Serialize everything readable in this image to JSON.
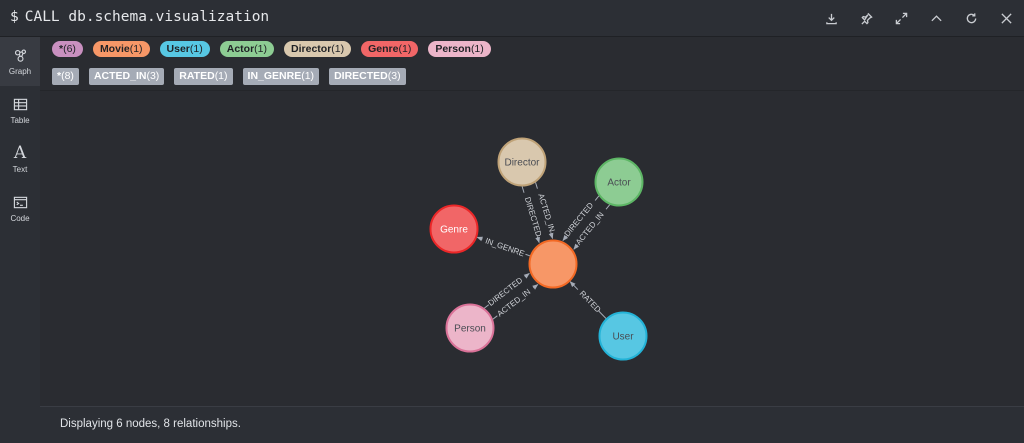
{
  "command": {
    "prompt": "$",
    "text": "CALL db.schema.visualization"
  },
  "toolbar": [
    "download-icon",
    "pin-icon",
    "expand-icon",
    "collapse-icon",
    "rerun-icon",
    "close-icon"
  ],
  "sidebar": {
    "items": [
      {
        "label": "Graph",
        "icon": "graph-icon",
        "active": true
      },
      {
        "label": "Table",
        "icon": "table-icon",
        "active": false
      },
      {
        "label": "Text",
        "icon": "text-icon",
        "glyph": "A",
        "active": false
      },
      {
        "label": "Code",
        "icon": "code-icon",
        "active": false
      }
    ]
  },
  "labels": [
    {
      "name": "*",
      "count": "(6)",
      "color": "#c990c0"
    },
    {
      "name": "Movie",
      "count": "(1)",
      "color": "#f79767"
    },
    {
      "name": "User",
      "count": "(1)",
      "color": "#57c7e3"
    },
    {
      "name": "Actor",
      "count": "(1)",
      "color": "#8dcc93"
    },
    {
      "name": "Director",
      "count": "(1)",
      "color": "#d9c8ae"
    },
    {
      "name": "Genre",
      "count": "(1)",
      "color": "#f16667"
    },
    {
      "name": "Person",
      "count": "(1)",
      "color": "#ecb5c9"
    }
  ],
  "relationships": [
    {
      "name": "*",
      "count": "(8)"
    },
    {
      "name": "ACTED_IN",
      "count": "(3)"
    },
    {
      "name": "RATED",
      "count": "(1)"
    },
    {
      "name": "IN_GENRE",
      "count": "(1)"
    },
    {
      "name": "DIRECTED",
      "count": "(3)"
    }
  ],
  "graph": {
    "nodes": [
      {
        "id": "movie",
        "label": "",
        "color": "#f79767",
        "stroke": "#f36924"
      },
      {
        "id": "director",
        "label": "Director",
        "color": "#d9c8ae",
        "stroke": "#c0a378"
      },
      {
        "id": "actor",
        "label": "Actor",
        "color": "#8dcc93",
        "stroke": "#5db665"
      },
      {
        "id": "genre",
        "label": "Genre",
        "color": "#f16667",
        "stroke": "#eb2728"
      },
      {
        "id": "person",
        "label": "Person",
        "color": "#ecb5c9",
        "stroke": "#da7298"
      },
      {
        "id": "user",
        "label": "User",
        "color": "#57c7e3",
        "stroke": "#23b3d7"
      }
    ],
    "edges": [
      {
        "from": "director",
        "to": "movie",
        "label": "ACTED_IN"
      },
      {
        "from": "director",
        "to": "movie",
        "label": "DIRECTED"
      },
      {
        "from": "actor",
        "to": "movie",
        "label": "ACTED_IN"
      },
      {
        "from": "actor",
        "to": "movie",
        "label": "DIRECTED"
      },
      {
        "from": "movie",
        "to": "genre",
        "label": "IN_GENRE"
      },
      {
        "from": "person",
        "to": "movie",
        "label": "DIRECTED"
      },
      {
        "from": "person",
        "to": "movie",
        "label": "ACTED_IN"
      },
      {
        "from": "user",
        "to": "movie",
        "label": "RATED"
      }
    ]
  },
  "status": {
    "text": "Displaying 6 nodes, 8 relationships."
  }
}
